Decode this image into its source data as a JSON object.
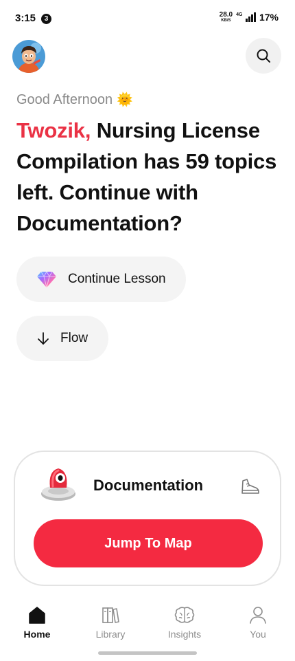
{
  "status_bar": {
    "time": "3:15",
    "notification_count": "3",
    "net_speed_value": "28.0",
    "net_speed_unit": "KB/S",
    "network_type": "4G",
    "battery": "17%"
  },
  "header": {
    "avatar_icon": "avatar-cartoon-icon",
    "search_icon": "search-icon"
  },
  "greeting": {
    "text": "Good Afternoon",
    "emoji": "🌞"
  },
  "headline": {
    "name": "Twozik,",
    "message": "Nursing License Compilation has 59 topics left. Continue with Documentation?"
  },
  "actions": {
    "continue_label": "Continue Lesson",
    "continue_icon": "gem-icon",
    "flow_label": "Flow",
    "flow_icon": "arrow-down-icon"
  },
  "card": {
    "title": "Documentation",
    "icon": "map-pin-3d-icon",
    "secondary_icon": "shoe-icon",
    "button_label": "Jump To Map"
  },
  "bottom_nav": {
    "items": [
      {
        "label": "Home",
        "icon": "home-icon",
        "active": true
      },
      {
        "label": "Library",
        "icon": "books-icon",
        "active": false
      },
      {
        "label": "Insights",
        "icon": "brain-icon",
        "active": false
      },
      {
        "label": "You",
        "icon": "person-icon",
        "active": false
      }
    ]
  },
  "colors": {
    "accent_red": "#f42a41",
    "name_red": "#ea3245",
    "pill_bg": "#f4f4f4",
    "muted_text": "#8a8a8a"
  }
}
